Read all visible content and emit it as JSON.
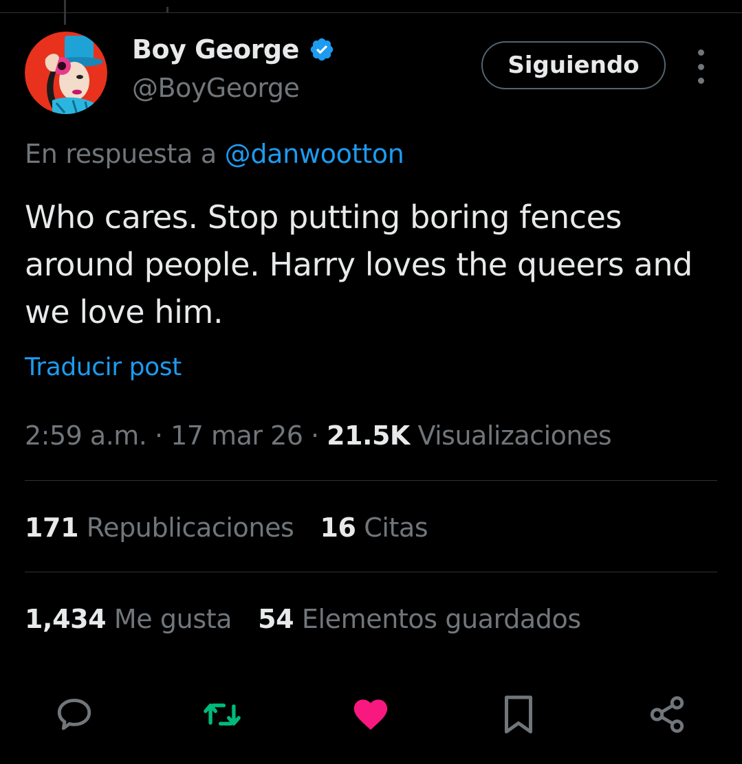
{
  "author": {
    "display_name": "Boy George",
    "handle": "@BoyGeorge",
    "verified": true,
    "avatar_icon": "profile-avatar"
  },
  "follow_button": {
    "label": "Siguiendo"
  },
  "reply_context": {
    "prefix": "En respuesta a ",
    "mention": "@danwootton"
  },
  "tweet": {
    "text": "Who cares. Stop putting boring fences around people. Harry loves the queers and we love him.",
    "translate_label": "Traducir post"
  },
  "meta": {
    "time": "2:59 a.m.",
    "sep1": " · ",
    "date": "17 mar 26",
    "sep2": " · ",
    "views_count": "21.5K",
    "views_label": " Visualizaciones"
  },
  "stats": {
    "reposts_count": "171",
    "reposts_label": " Republicaciones",
    "quotes_count": "16",
    "quotes_label": " Citas",
    "likes_count": "1,434",
    "likes_label": " Me gusta",
    "bookmarks_count": "54",
    "bookmarks_label": " Elementos guardados"
  },
  "actions": {
    "reply_icon": "reply-icon",
    "repost_icon": "repost-icon",
    "like_icon": "heart-icon",
    "bookmark_icon": "bookmark-icon",
    "share_icon": "share-icon"
  },
  "colors": {
    "background": "#000000",
    "text": "#e7e9ea",
    "secondary": "#71767b",
    "link": "#1d9bf0",
    "verified": "#1d9bf0",
    "repost_active": "#00ba7c",
    "like_active": "#f91880",
    "divider": "#2f3336"
  }
}
